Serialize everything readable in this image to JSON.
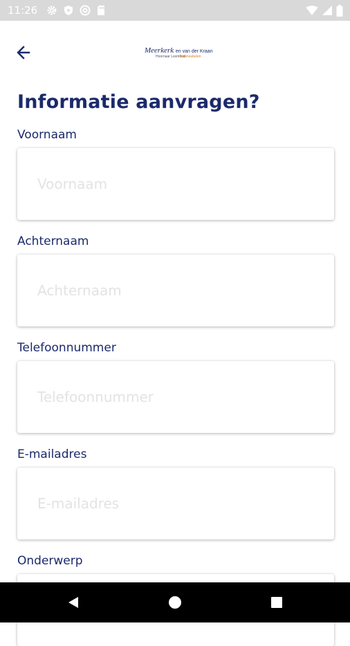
{
  "status_bar": {
    "time": "11:26",
    "left_icons": [
      "gear-icon",
      "play-protect-icon",
      "at-sign-icon",
      "sd-card-icon"
    ],
    "right_icons": [
      "wifi-icon",
      "signal-icon",
      "battery-icon"
    ]
  },
  "app_bar": {
    "back_icon": "arrow-left-icon",
    "logo": {
      "main": "Meerkerk",
      "suffix": "en van der Kraan",
      "sub": "Hoornaar Lexmond",
      "sub2": "Tuinmeubelen"
    }
  },
  "form": {
    "title": "Informatie aanvragen?",
    "fields": [
      {
        "label": "Voornaam",
        "placeholder": "Voornaam",
        "value": ""
      },
      {
        "label": "Achternaam",
        "placeholder": "Achternaam",
        "value": ""
      },
      {
        "label": "Telefoonnummer",
        "placeholder": "Telefoonnummer",
        "value": ""
      },
      {
        "label": "E-mailadres",
        "placeholder": "E-mailadres",
        "value": ""
      },
      {
        "label": "Onderwerp",
        "placeholder": "",
        "value": ""
      }
    ]
  },
  "nav_bar": {
    "icons": [
      "back-triangle-icon",
      "home-circle-icon",
      "recents-square-icon"
    ]
  },
  "colors": {
    "primary": "#1b2a6b",
    "status_bar": "#d9d9d9",
    "nav_bar": "#000000",
    "placeholder": "#e3e3e3"
  }
}
